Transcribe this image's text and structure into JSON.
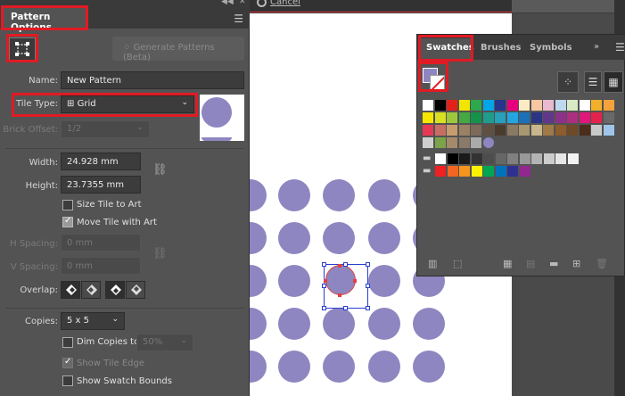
{
  "topbar": {
    "cancel_label": "Cancel"
  },
  "pattern_panel": {
    "title": "Pattern Options",
    "generate_label": "Generate Patterns (Beta)",
    "name_label": "Name:",
    "name_value": "New Pattern",
    "tile_type_label": "Tile Type:",
    "tile_type_value": "Grid",
    "brick_offset_label": "Brick Offset:",
    "brick_offset_value": "1/2",
    "width_label": "Width:",
    "width_value": "24.928 mm",
    "height_label": "Height:",
    "height_value": "23.7355 mm",
    "size_tile_label": "Size Tile to Art",
    "size_tile_checked": false,
    "move_tile_label": "Move Tile with Art",
    "move_tile_checked": true,
    "h_spacing_label": "H Spacing:",
    "h_spacing_value": "0 mm",
    "v_spacing_label": "V Spacing:",
    "v_spacing_value": "0 mm",
    "overlap_label": "Overlap:",
    "copies_label": "Copies:",
    "copies_value": "5 x 5",
    "dim_copies_label": "Dim Copies to:",
    "dim_copies_value": "50%",
    "dim_copies_checked": false,
    "show_tile_edge_label": "Show Tile Edge",
    "show_tile_edge_checked": true,
    "show_swatch_bounds_label": "Show Swatch Bounds",
    "show_swatch_bounds_checked": false
  },
  "swatches_panel": {
    "tabs": [
      "Swatches",
      "Brushes",
      "Symbols"
    ],
    "more_label": "»",
    "fill_color": "#8e86c0",
    "rows": [
      [
        "#ffffff",
        "#000000",
        "#e32119",
        "#f2e500",
        "#2da84a",
        "#00a6e6",
        "#27348b",
        "#e6007e",
        "#fcebc3",
        "#f6c7a1",
        "#e9b9cf",
        "#bfd8ef",
        "#d9ebc6",
        "#ffffff",
        "#f2b02a",
        "#f5a23c"
      ],
      [
        "#f6e600",
        "#d9e021",
        "#9dc83e",
        "#45a843",
        "#14934b",
        "#1f9c8c",
        "#27a1b9",
        "#23a6df",
        "#1b70b8",
        "#2a3584",
        "#61378c",
        "#8c3188",
        "#ad2e81",
        "#e0177b",
        "#e4224b",
        "#696969"
      ],
      [
        "#e73956",
        "#c86d63",
        "#c69c6d",
        "#9b8163",
        "#7e6a5a",
        "#5f5042",
        "#4a3c2c",
        "#8a7a63",
        "#a89872",
        "#c8b78d",
        "#a07a47",
        "#8f5c2c",
        "#6e4a27",
        "#4a2d1a",
        "#c9c9c9",
        "#9fc6ea"
      ],
      [
        "#ffffff",
        "#000000",
        "#1a1a1a",
        "#333333",
        "#4d4d4d",
        "#666666",
        "#808080",
        "#999999",
        "#b3b3b3",
        "#cccccc",
        "#e6e6e6",
        "#f2f2f2"
      ],
      [
        "#ee2024",
        "#f26522",
        "#f7941d",
        "#fff200",
        "#00a651",
        "#0072bc",
        "#2e3192",
        "#92278f"
      ]
    ]
  }
}
